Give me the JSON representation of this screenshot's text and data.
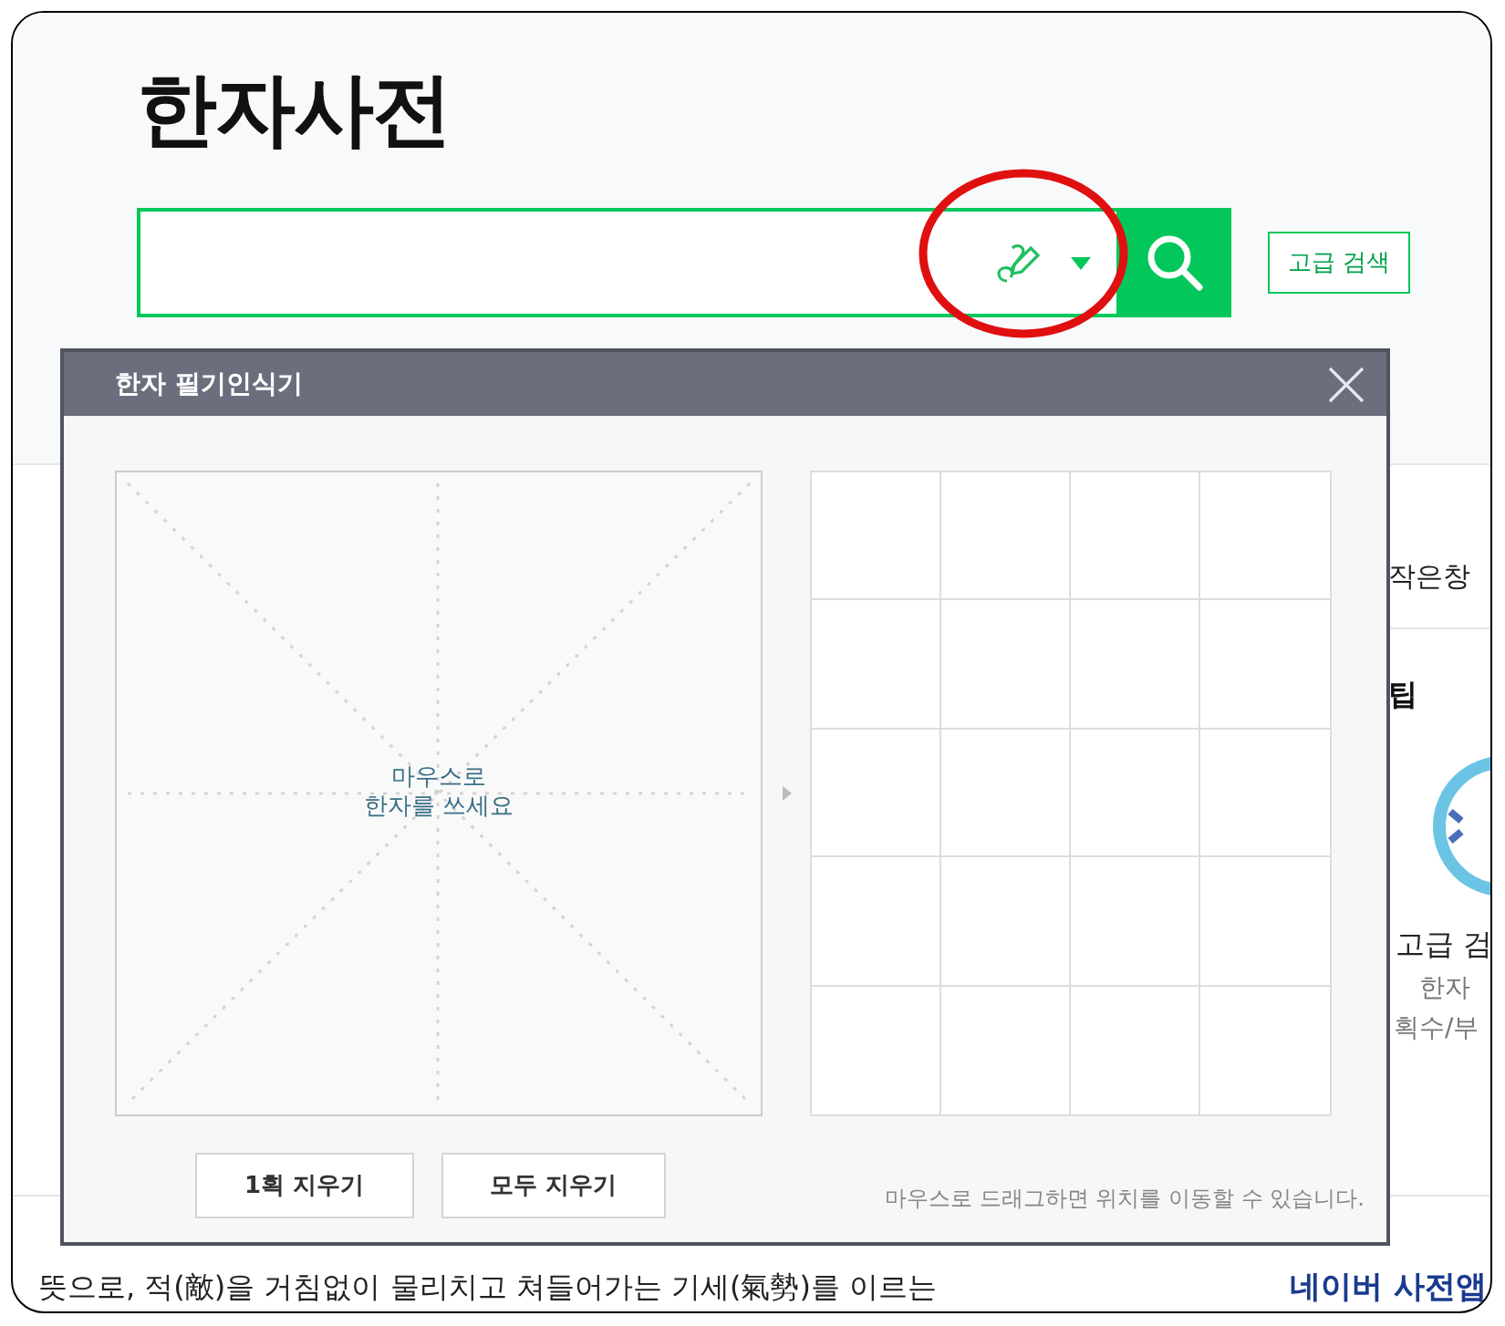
{
  "page": {
    "title": "한자사전",
    "advanced_button": "고급 검색"
  },
  "sidebar": {
    "small_window": "작은창",
    "tip_heading": "팁",
    "advanced_heading": "고급 검",
    "advanced_line_1": "한자",
    "advanced_line_2": "획수/부",
    "app_link": "네이버 사전앱"
  },
  "definition": "뜻으로, 적(敵)을 거침없이 물리치고 쳐들어가는 기세(氣勢)를 이르는",
  "popup": {
    "title": "한자 필기인식기",
    "canvas_hint": "마우스로\n한자를 쓰세요",
    "buttons": [
      "1획 지우기",
      "모두 지우기"
    ],
    "drag_hint": "마우스로 드래그하면 위치를 이동할 수 있습니다."
  }
}
